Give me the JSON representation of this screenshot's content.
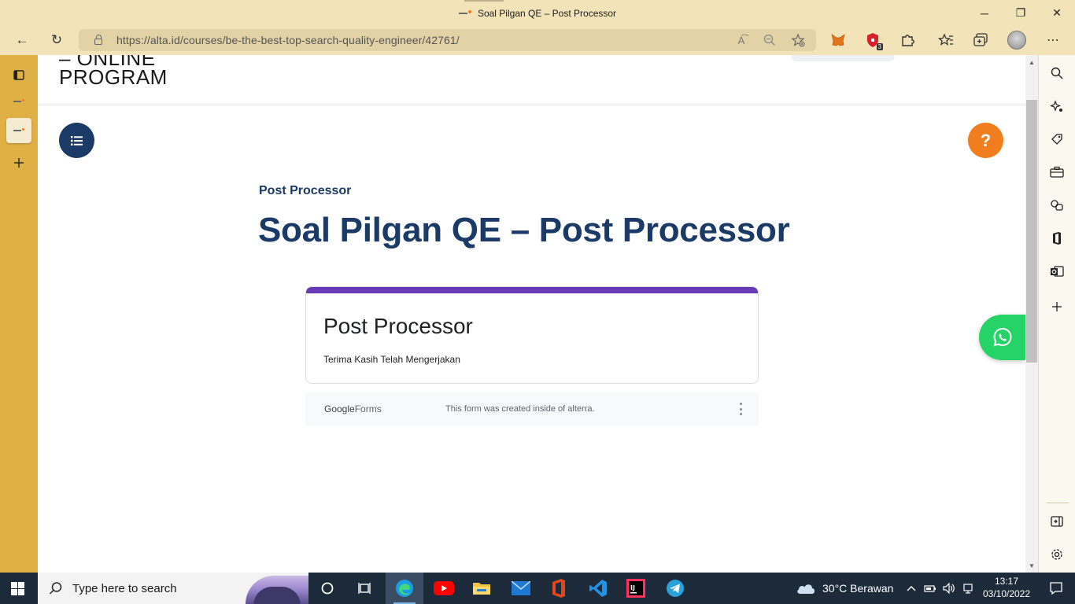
{
  "window": {
    "title": "Soal Pilgan QE – Post Processor",
    "controls": {
      "minimize": "─",
      "restore": "❐",
      "close": "✕"
    }
  },
  "browser": {
    "url": "https://alta.id/courses/be-the-best-top-search-quality-engineer/42761/",
    "extension_badge": "3",
    "nav_icons": {
      "back": "←",
      "refresh": "↻",
      "more": "⋯"
    }
  },
  "site": {
    "logo_line1": "– ONLINE",
    "logo_line2": "PROGRAM",
    "help_label": "?"
  },
  "page": {
    "breadcrumb": "Post Processor",
    "title": "Soal Pilgan QE – Post Processor"
  },
  "form": {
    "title": "Post Processor",
    "description": "Terima Kasih Telah Mengerjakan",
    "footer_brand_google": "Google",
    "footer_brand_forms": "Forms",
    "footer_note": "This form was created inside of alterra.",
    "accent_color": "#673ab7"
  },
  "taskbar": {
    "search_placeholder": "Type here to search",
    "weather": "30°C  Berawan",
    "time": "13:17",
    "date": "03/10/2022"
  },
  "colors": {
    "title_navy": "#1b3a66",
    "help_orange": "#f07d1e",
    "whatsapp_green": "#25d366",
    "browser_chrome": "#f2e3b8",
    "vertical_tabs": "#dfb046"
  }
}
